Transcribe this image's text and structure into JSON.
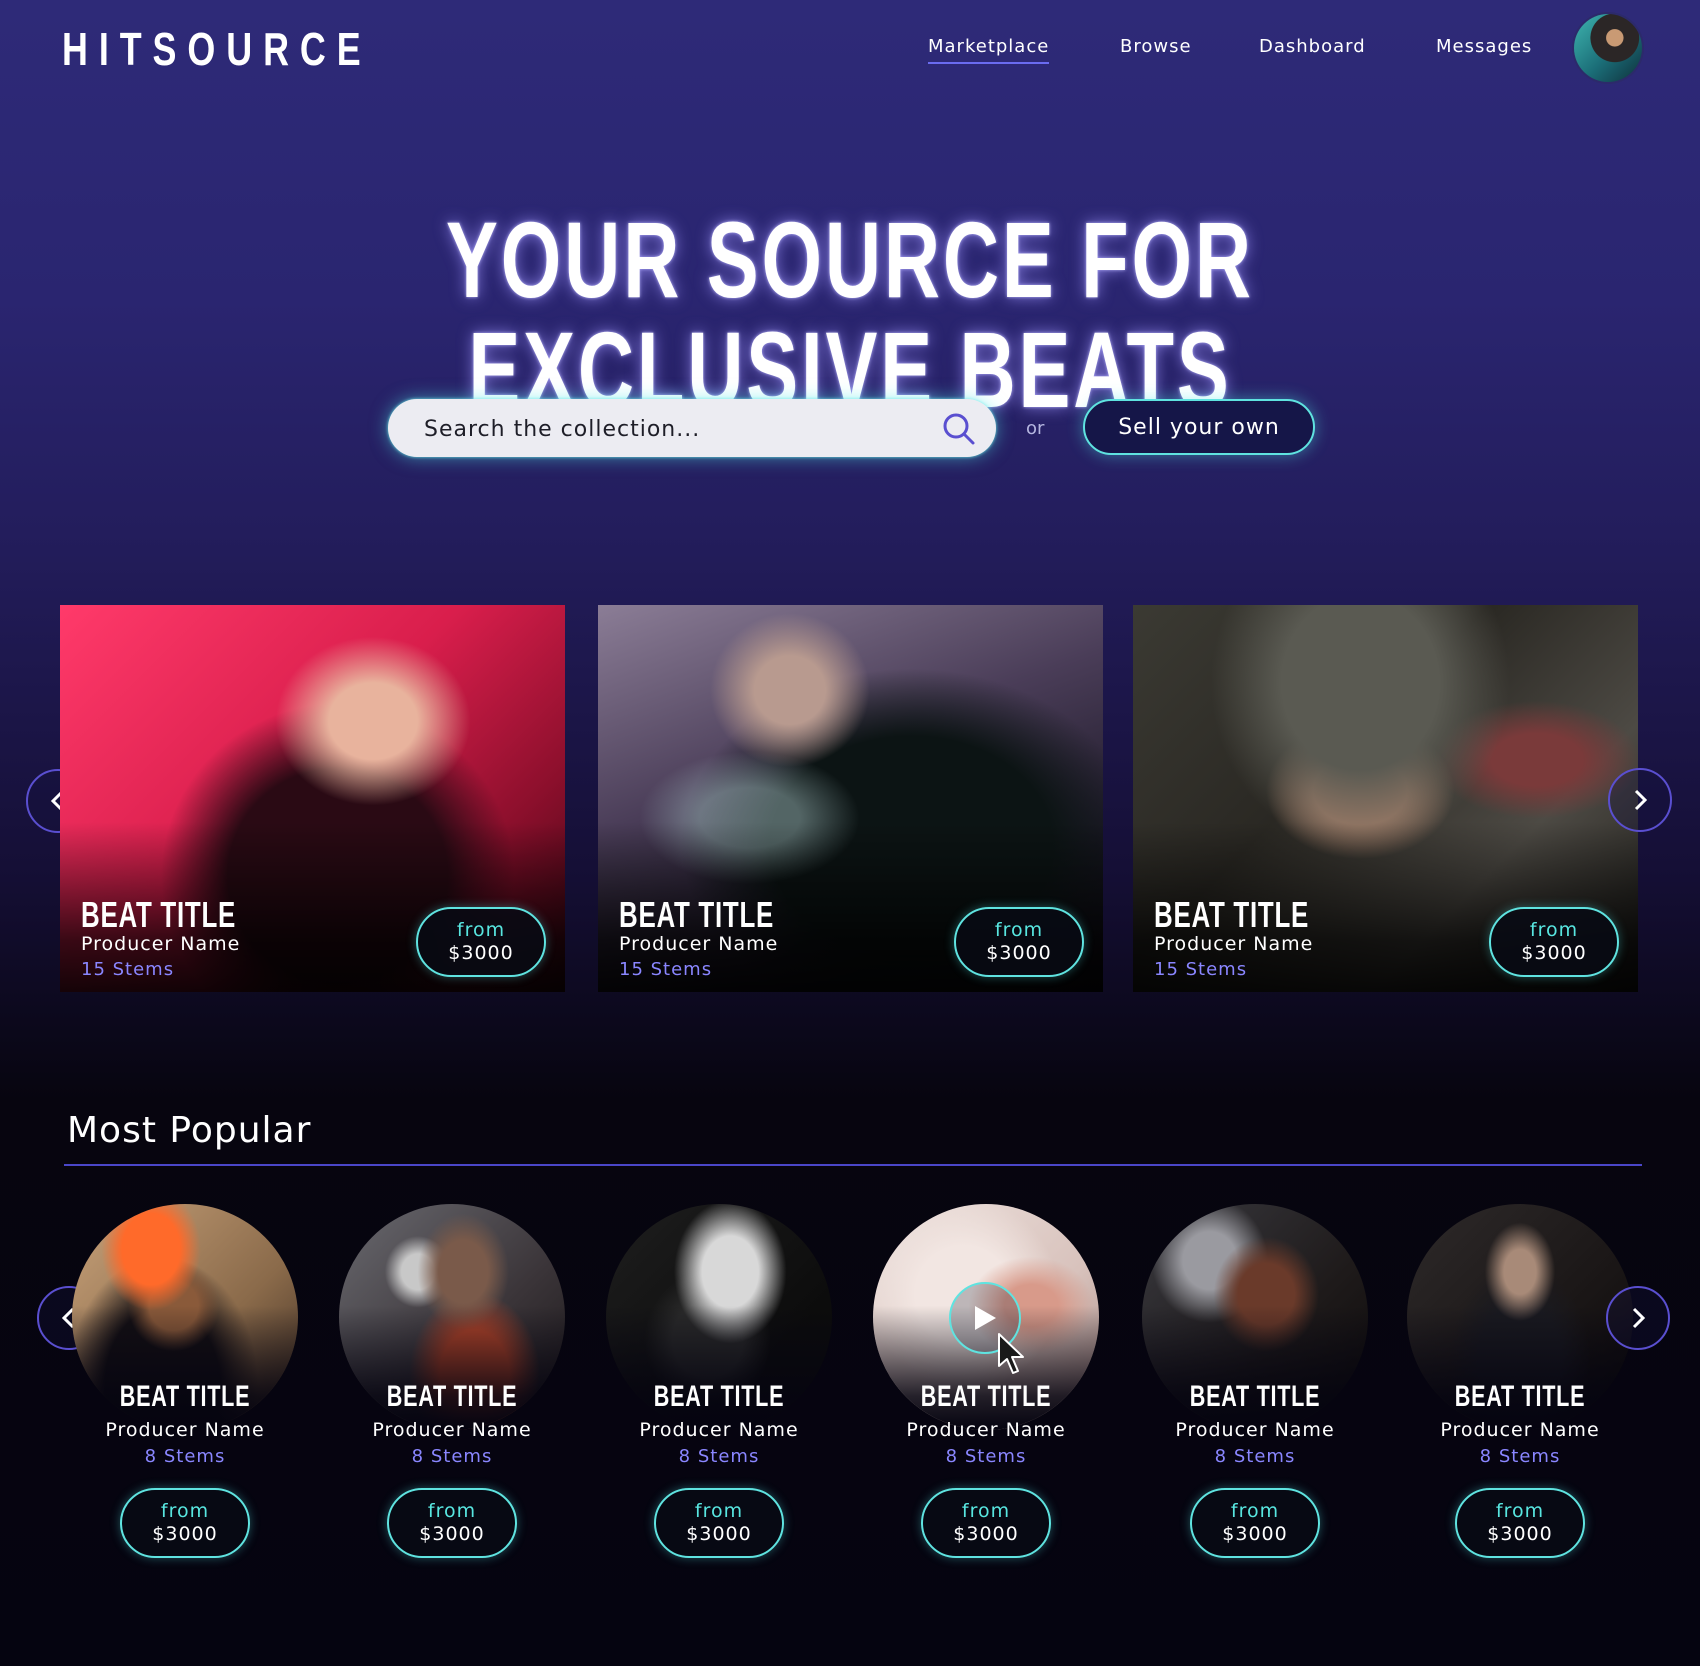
{
  "brand": {
    "logo": "HITSOURCE"
  },
  "nav": {
    "items": [
      {
        "label": "Marketplace",
        "active": true
      },
      {
        "label": "Browse",
        "active": false
      },
      {
        "label": "Dashboard",
        "active": false
      },
      {
        "label": "Messages",
        "active": false
      }
    ],
    "avatar_icon": "user-avatar"
  },
  "hero": {
    "title": "YOUR SOURCE FOR EXCLUSIVE BEATS",
    "search_placeholder": "Search the collection...",
    "search_icon": "search-icon",
    "or_label": "or",
    "sell_label": "Sell your own"
  },
  "featured": {
    "cards": [
      {
        "title": "BEAT TITLE",
        "producer": "Producer Name",
        "stems": "15 Stems",
        "price_from": "from",
        "price": "$3000"
      },
      {
        "title": "BEAT TITLE",
        "producer": "Producer Name",
        "stems": "15 Stems",
        "price_from": "from",
        "price": "$3000"
      },
      {
        "title": "BEAT TITLE",
        "producer": "Producer Name",
        "stems": "15 Stems",
        "price_from": "from",
        "price": "$3000"
      }
    ]
  },
  "popular": {
    "title": "Most Popular",
    "items": [
      {
        "title": "BEAT TITLE",
        "producer": "Producer Name",
        "stems": "8 Stems",
        "price_from": "from",
        "price": "$3000"
      },
      {
        "title": "BEAT TITLE",
        "producer": "Producer Name",
        "stems": "8 Stems",
        "price_from": "from",
        "price": "$3000"
      },
      {
        "title": "BEAT TITLE",
        "producer": "Producer Name",
        "stems": "8 Stems",
        "price_from": "from",
        "price": "$3000"
      },
      {
        "title": "BEAT TITLE",
        "producer": "Producer Name",
        "stems": "8 Stems",
        "price_from": "from",
        "price": "$3000",
        "hovered": true
      },
      {
        "title": "BEAT TITLE",
        "producer": "Producer Name",
        "stems": "8 Stems",
        "price_from": "from",
        "price": "$3000"
      },
      {
        "title": "BEAT TITLE",
        "producer": "Producer Name",
        "stems": "8 Stems",
        "price_from": "from",
        "price": "$3000"
      }
    ]
  },
  "colors": {
    "accent_cyan": "#5fe3e0",
    "accent_purple": "#8a86ff",
    "nav_underline": "#6b6cf0",
    "bg_top": "#2e2a78",
    "bg_bottom": "#050410"
  }
}
